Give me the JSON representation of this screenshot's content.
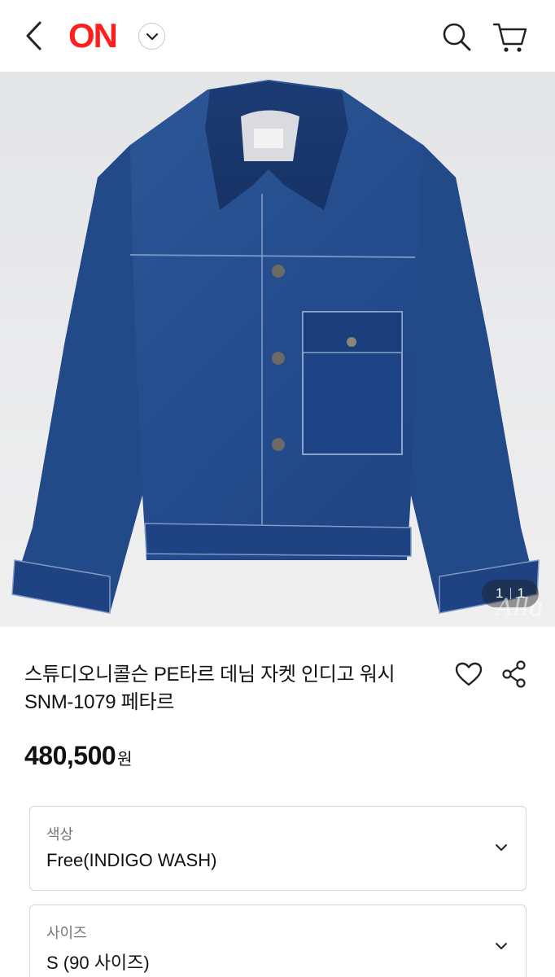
{
  "header": {
    "logo": "ON",
    "icons": {
      "back": "chevron-left-icon",
      "logo_menu": "chevron-down-icon",
      "search": "search-icon",
      "cart": "cart-icon"
    },
    "brand_color": "#ff1e1e"
  },
  "gallery": {
    "counter_current": "1",
    "counter_total": "1",
    "watermark": "Alla"
  },
  "product": {
    "title": "스튜디오니콜슨 PE타르 데님 자켓 인디고 워시 SNM-1079 페타르",
    "price": "480,500",
    "price_unit": "원",
    "icons": {
      "like": "heart-icon",
      "share": "share-icon"
    }
  },
  "options": [
    {
      "label": "색상",
      "value": "Free(INDIGO WASH)"
    },
    {
      "label": "사이즈",
      "value": "S (90 사이즈)"
    }
  ]
}
